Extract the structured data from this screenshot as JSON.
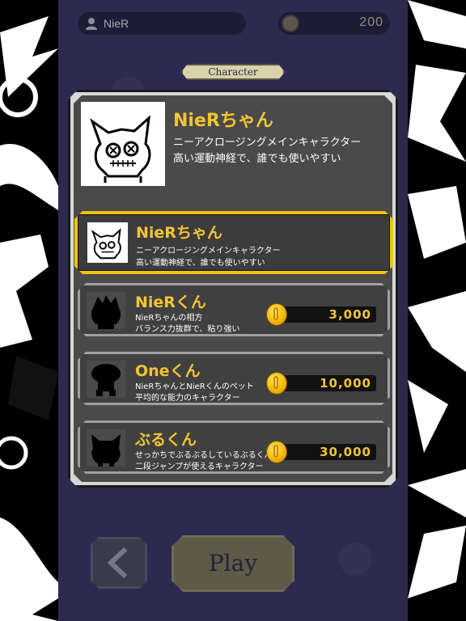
{
  "header": {
    "user_name": "NieR",
    "coins": "200"
  },
  "section_label": "Character",
  "selected": {
    "name": "NieRちゃん",
    "desc_line1": "ニーアクロージングメインキャラクター",
    "desc_line2": "高い運動神経で、誰でも使いやすい"
  },
  "characters": [
    {
      "name": "NieRちゃん",
      "desc_line1": "ニーアクロージングメインキャラクター",
      "desc_line2": "高い運動神経で、誰でも使いやすい",
      "price": ""
    },
    {
      "name": "NieRくん",
      "desc_line1": "NieRちゃんの相方",
      "desc_line2": "バランス力抜群で、粘り強い",
      "price": "3,000"
    },
    {
      "name": "Oneくん",
      "desc_line1": "NieRちゃんとNieRくんのペット",
      "desc_line2": "平均的な能力のキャラクター",
      "price": "10,000"
    },
    {
      "name": "ぶるくん",
      "desc_line1": "せっかちでぶるぶるしているぶるくん",
      "desc_line2": "二段ジャンプが使えるキャラクター",
      "price": "30,000"
    }
  ],
  "footer": {
    "back_icon": "chevron-left-icon",
    "play_label": "Play"
  },
  "colors": {
    "accent_gold": "#f4c531",
    "panel_bg": "#2c2b4f",
    "selected_border": "#f1c40f"
  }
}
